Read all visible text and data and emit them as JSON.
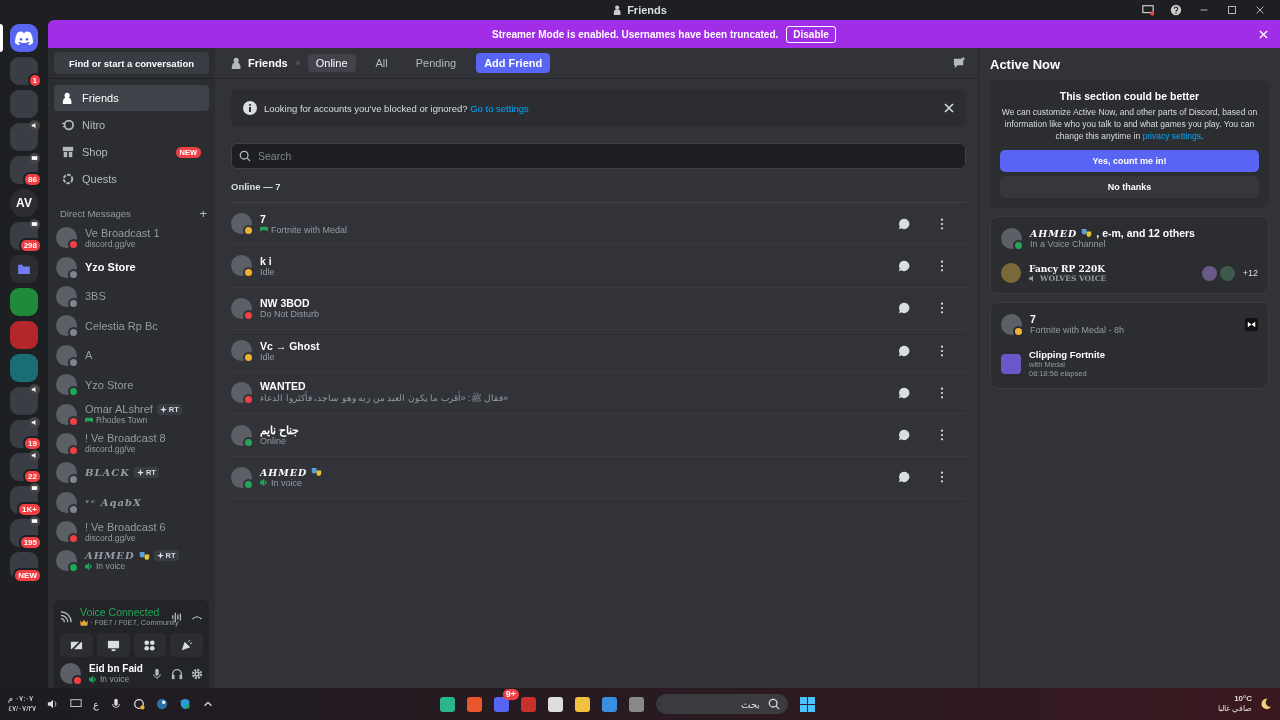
{
  "window": {
    "title": "Friends"
  },
  "banner": {
    "text": "Streamer Mode is enabled. Usernames have been truncated.",
    "button": "Disable"
  },
  "servers": [
    {
      "kind": "home",
      "selected": true
    },
    {
      "kind": "picture",
      "badge": "1"
    },
    {
      "kind": "picture"
    },
    {
      "kind": "picture",
      "speaker": true
    },
    {
      "kind": "picture",
      "badge": "86",
      "screen": true
    },
    {
      "kind": "text",
      "label": "AV"
    },
    {
      "kind": "picture",
      "badge": "298",
      "screen": true
    },
    {
      "kind": "folder"
    },
    {
      "kind": "picture",
      "color": "#1f8a3a"
    },
    {
      "kind": "picture",
      "color": "#b3262a"
    },
    {
      "kind": "picture",
      "color": "#1a6e74"
    },
    {
      "kind": "picture",
      "speaker": true
    },
    {
      "kind": "picture",
      "badge": "19",
      "speaker": true
    },
    {
      "kind": "picture",
      "badge": "22",
      "speaker": true
    },
    {
      "kind": "picture",
      "badge": "1K+",
      "screen": true
    },
    {
      "kind": "picture",
      "badge": "195",
      "screen": true
    },
    {
      "kind": "picture",
      "badge": "NEW"
    }
  ],
  "sidebar": {
    "search": "Find or start a conversation",
    "nav": [
      {
        "kind": "friends",
        "label": "Friends",
        "selected": true
      },
      {
        "kind": "nitro",
        "label": "Nitro",
        "selected": false
      },
      {
        "kind": "shop",
        "label": "Shop",
        "selected": false,
        "badge": "NEW"
      },
      {
        "kind": "quests",
        "label": "Quests",
        "selected": false
      }
    ],
    "dm_header": "Direct Messages",
    "dm_add": "+",
    "dms": [
      {
        "name": "Ve Broadcast 1",
        "sub": "discord.gg/ve",
        "color": "#f23f43",
        "unread": false,
        "fancy": false
      },
      {
        "name": "Yzo Store",
        "color": "#80848e",
        "unread": true,
        "fancy": false
      },
      {
        "name": "3BS",
        "color": "#80848e",
        "unread": false,
        "fancy": false
      },
      {
        "name": "Celestia Rp Bc",
        "color": "#80848e",
        "unread": false,
        "fancy": false
      },
      {
        "name": "A",
        "color": "#80848e",
        "unread": false,
        "fancy": false
      },
      {
        "name": "Yzo Store",
        "color": "#23a55a",
        "unread": false,
        "fancy": false
      },
      {
        "name": "Omar ALshref",
        "tag": "RT",
        "sub": "Rhodes Town",
        "kind": "game",
        "color": "#f23f43",
        "unread": false,
        "fancy": false
      },
      {
        "name": "! Ve Broadcast 8",
        "sub": "discord.gg/ve",
        "color": "#f23f43",
        "unread": false,
        "fancy": false
      },
      {
        "name": "BLACK",
        "tag": "RT",
        "color": "#80848e",
        "unread": false,
        "fancy": true
      },
      {
        "name": "ᵛᶜ AqabX",
        "color": "#80848e",
        "unread": false,
        "fancy": true
      },
      {
        "name": "! Ve Broadcast 6",
        "sub": "discord.gg/ve",
        "color": "#f23f43",
        "unread": false,
        "fancy": false
      },
      {
        "name": "AHMED",
        "mask": true,
        "tag": "RT",
        "sub": "In voice",
        "kind": "voice",
        "color": "#23a55a",
        "unread": false,
        "fancy": true
      }
    ],
    "voice": {
      "title": "Voice Connected",
      "channel": "· F0E7 / F0E7, Community"
    },
    "user": {
      "name": "Eid bn Faid",
      "sub": "In voice",
      "color": "#f23f43"
    }
  },
  "tabs": [
    {
      "label": "Friends",
      "kind": "title"
    },
    {
      "label": "Online",
      "selected": true,
      "kind": "tab"
    },
    {
      "label": "All",
      "selected": false,
      "kind": "tab"
    },
    {
      "label": "Pending",
      "selected": false,
      "kind": "tab"
    },
    {
      "label": "Add Friend",
      "kind": "primary"
    }
  ],
  "notice": {
    "text": "Looking for accounts you've blocked or ignored?",
    "link": "Go to settings"
  },
  "search": {
    "placeholder": "Search"
  },
  "online_header": "Online — 7",
  "friends": [
    {
      "name": "7",
      "sub": "Fortnite with Medal",
      "kind": "game",
      "color": "#f0b232",
      "fancy": false
    },
    {
      "name": "k i",
      "sub": "Idle",
      "color": "#f0b232",
      "fancy": false
    },
    {
      "name": "NW 3BOD",
      "sub": "Do Not Disturb",
      "color": "#f23f43",
      "fancy": false
    },
    {
      "name": "Vc → Ghost",
      "sub": "Idle",
      "color": "#f0b232",
      "fancy": false
    },
    {
      "name": "WANTED",
      "sub": "فقال ﷺ: «أقرب ما يكون العبد من ربه وهو ساجد، فأكثروا الدعاء»",
      "color": "#f23f43",
      "fancy": false
    },
    {
      "name": "جناح نايم",
      "sub": "Online",
      "color": "#23a55a",
      "fancy": false
    },
    {
      "name": "AHMED",
      "mask": true,
      "sub": "In voice",
      "kind": "voice",
      "color": "#23a55a",
      "fancy": true
    }
  ],
  "active_now": {
    "title": "Active Now",
    "prompt": {
      "title": "This section could be better",
      "text": "We can customize Active Now, and other parts of Discord, based on information like who you talk to and what games you play. You can change this anytime in",
      "link": "privacy settings",
      "after": ".",
      "yes": "Yes, count me in!",
      "no": "No thanks"
    },
    "voice_card": {
      "name": "AHMED",
      "rest": ", e-m, and 12 others",
      "sub": "In a Voice Channel",
      "color": "#23a55a",
      "server": "Fancy RP 220K",
      "channel": "WOLVES VOICE",
      "more": "+12"
    },
    "game_card": {
      "name": "7",
      "sub": "Fortnite with Medal - 8h",
      "color": "#f0b232",
      "activity": "Clipping Fortnite",
      "detail": "with Medal",
      "elapsed": "08:18:56 elapsed"
    }
  },
  "taskbar": {
    "time": "٠٧:٠٧ م",
    "date": "٤٧/٠٧/٢٧",
    "lang": "ع",
    "search": "بحث",
    "discord_badge": "9+",
    "temp": "10°C",
    "weather": "صافي غالبا"
  }
}
